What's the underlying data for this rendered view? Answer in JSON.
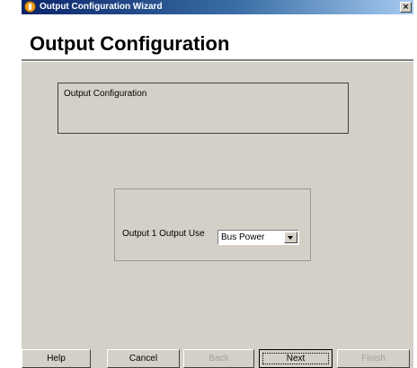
{
  "window": {
    "title": "Output Configuration Wizard",
    "close_symbol": "×",
    "icon": "app-icon"
  },
  "header": {
    "title": "Output Configuration"
  },
  "group": {
    "label": "Output Configuration"
  },
  "output_field": {
    "label": "Output 1 Output Use",
    "selected": "Bus Power"
  },
  "buttons": {
    "help": "Help",
    "cancel": "Cancel",
    "back": "Back",
    "next": "Next",
    "finish": "Finish"
  },
  "colors": {
    "title_bar": "#0a246a",
    "dialog_face": "#d4d0c8",
    "disabled_text": "#a0a0a0"
  }
}
